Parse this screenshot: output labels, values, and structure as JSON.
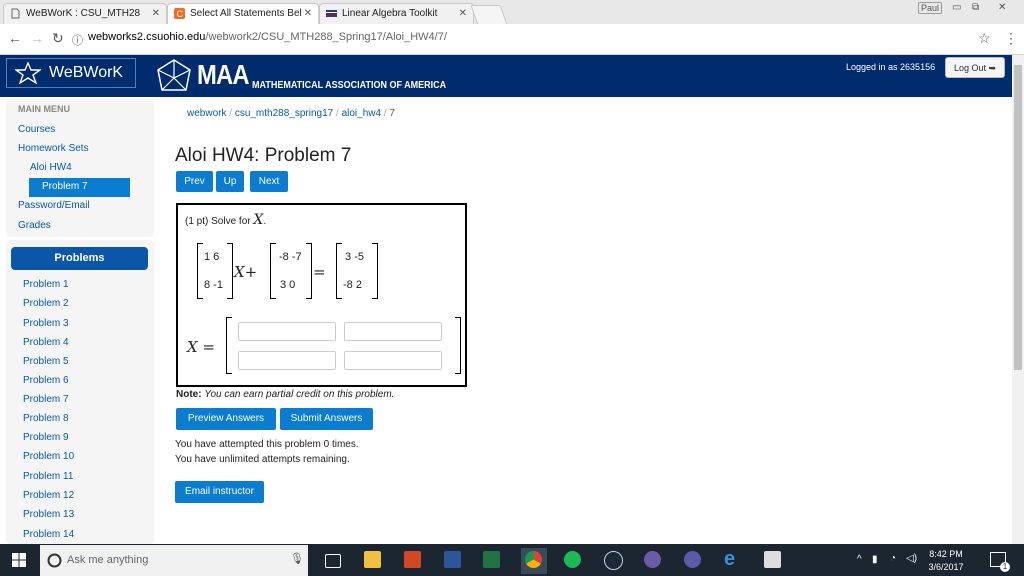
{
  "browser": {
    "tabs": [
      {
        "title": "WeBWorK : CSU_MTH28",
        "active": false
      },
      {
        "title": "Select All Statements Bel",
        "active": true
      },
      {
        "title": "Linear Algebra Toolkit",
        "active": false
      }
    ],
    "profile": "Paul",
    "url_host": "webworks2.csuohio.edu",
    "url_path": "/webwork2/CSU_MTH288_Spring17/Aloi_HW4/7/"
  },
  "header": {
    "webwork_label": "WeBWorK",
    "maa_big": "MAA",
    "maa_small": "MATHEMATICAL ASSOCIATION OF AMERICA",
    "logged_in": "Logged in as 2635156",
    "logout": "Log Out"
  },
  "sidebar": {
    "main_menu": "MAIN MENU",
    "courses": "Courses",
    "homework_sets": "Homework Sets",
    "set": "Aloi HW4",
    "problem": "Problem 7",
    "password": "Password/Email",
    "grades": "Grades",
    "problems_header": "Problems",
    "problems": [
      "Problem 1",
      "Problem 2",
      "Problem 3",
      "Problem 4",
      "Problem 5",
      "Problem 6",
      "Problem 7",
      "Problem 8",
      "Problem 9",
      "Problem 10",
      "Problem 11",
      "Problem 12",
      "Problem 13",
      "Problem 14"
    ]
  },
  "breadcrumb": {
    "a": "webwork",
    "b": "csu_mth288_spring17",
    "c": "aloi_hw4",
    "d": "7",
    "sep": "/"
  },
  "problem": {
    "title": "Aloi HW4: Problem 7",
    "prev": "Prev",
    "up": "Up",
    "next": "Next",
    "points": "(1 pt) Solve for",
    "var": "X",
    "period": ".",
    "matA": [
      "1 6",
      "8 -1"
    ],
    "matB": [
      "-8 -7",
      "3 0"
    ],
    "matC": [
      "3 -5",
      "-8 2"
    ],
    "xplus": "X+",
    "equals": "=",
    "x_equals": "X =",
    "answers": [
      "",
      "",
      "",
      ""
    ],
    "note_label": "Note:",
    "note_text": "You can earn partial credit on this problem."
  },
  "actions": {
    "preview": "Preview Answers",
    "submit": "Submit Answers",
    "attempted": "You have attempted this problem 0 times.",
    "remaining": "You have unlimited attempts remaining.",
    "email": "Email instructor"
  },
  "taskbar": {
    "search_placeholder": "Ask me anything",
    "time": "8:42 PM",
    "date": "3/6/2017",
    "notif_count": "1"
  }
}
